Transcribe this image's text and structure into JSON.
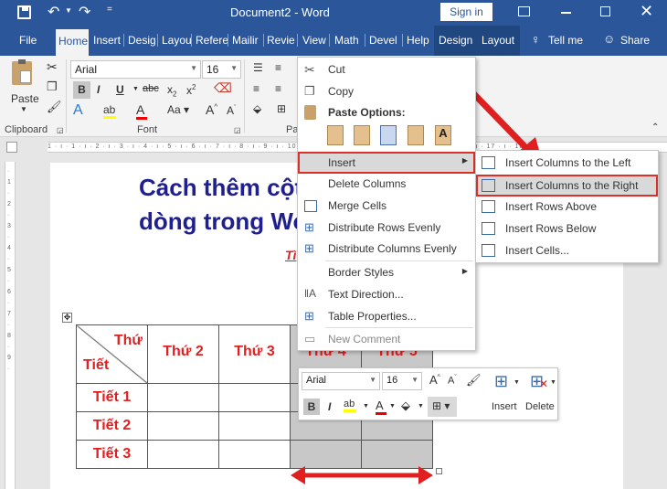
{
  "window": {
    "doc_title": "Document2 - Word",
    "sign_in": "Sign in"
  },
  "tabs": [
    {
      "label": "File"
    },
    {
      "label": "Home"
    },
    {
      "label": "Insert"
    },
    {
      "label": "Desig"
    },
    {
      "label": "Layou"
    },
    {
      "label": "Refere"
    },
    {
      "label": "Mailir"
    },
    {
      "label": "Revie"
    },
    {
      "label": "View"
    },
    {
      "label": "Math"
    },
    {
      "label": "Devel"
    },
    {
      "label": "Help"
    },
    {
      "label": "Design"
    },
    {
      "label": "Layout"
    }
  ],
  "tell_me": "Tell me",
  "share": "Share",
  "ribbon": {
    "paste": "Paste",
    "clipboard": "Clipboard",
    "font_group": "Font",
    "paragraph_group": "Pa",
    "font_name": "Arial",
    "font_size": "16"
  },
  "document": {
    "heading1": "Cách thêm cột",
    "heading2": "dòng trong Wo",
    "subtitle": "Tì"
  },
  "table": {
    "header_top": "Thứ",
    "header_bottom": "Tiết",
    "headers": [
      "Thứ 2",
      "Thứ 3",
      "Thứ 4",
      "Thứ 5"
    ],
    "rows": [
      "Tiết 1",
      "Tiết 2",
      "Tiết 3"
    ]
  },
  "context_menu": {
    "cut": "Cut",
    "copy": "Copy",
    "paste_options": "Paste Options:",
    "insert": "Insert",
    "delete_columns": "Delete Columns",
    "merge_cells": "Merge Cells",
    "distribute_rows": "Distribute Rows Evenly",
    "distribute_columns": "Distribute Columns Evenly",
    "border_styles": "Border Styles",
    "text_direction": "Text Direction...",
    "table_properties": "Table Properties...",
    "new_comment": "New Comment"
  },
  "submenu": {
    "insert_left": "Insert Columns to the Left",
    "insert_right": "Insert Columns to the Right",
    "insert_above": "Insert Rows Above",
    "insert_below": "Insert Rows Below",
    "insert_cells": "Insert Cells..."
  },
  "mini_toolbar": {
    "font": "Arial",
    "size": "16",
    "insert": "Insert",
    "delete": "Delete"
  },
  "colors": {
    "word_blue": "#2b579a",
    "highlight_red": "#d9302b",
    "heading_navy": "#1f1f8f",
    "table_red": "#e02020"
  }
}
